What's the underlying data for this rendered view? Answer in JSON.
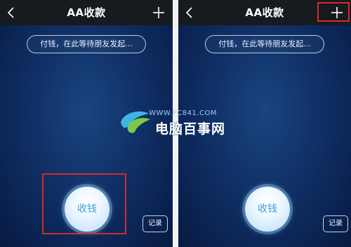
{
  "screens": [
    {
      "title": "AA收款",
      "prompt": "付钱，在此等待朋友发起...",
      "collect_label": "收钱",
      "record_label": "记录"
    },
    {
      "title": "AA收款",
      "prompt": "付钱，在此等待朋友发起...",
      "collect_label": "收钱",
      "record_label": "记录"
    }
  ],
  "watermark": {
    "url": "WWW.PC841.COM",
    "text": "电脑百事网"
  },
  "colors": {
    "highlight": "#d42a2a",
    "navbar": "#171a1f",
    "background": "#103066",
    "button_text": "#3f9fd6"
  },
  "icons": [
    "back-icon",
    "plus-icon"
  ]
}
